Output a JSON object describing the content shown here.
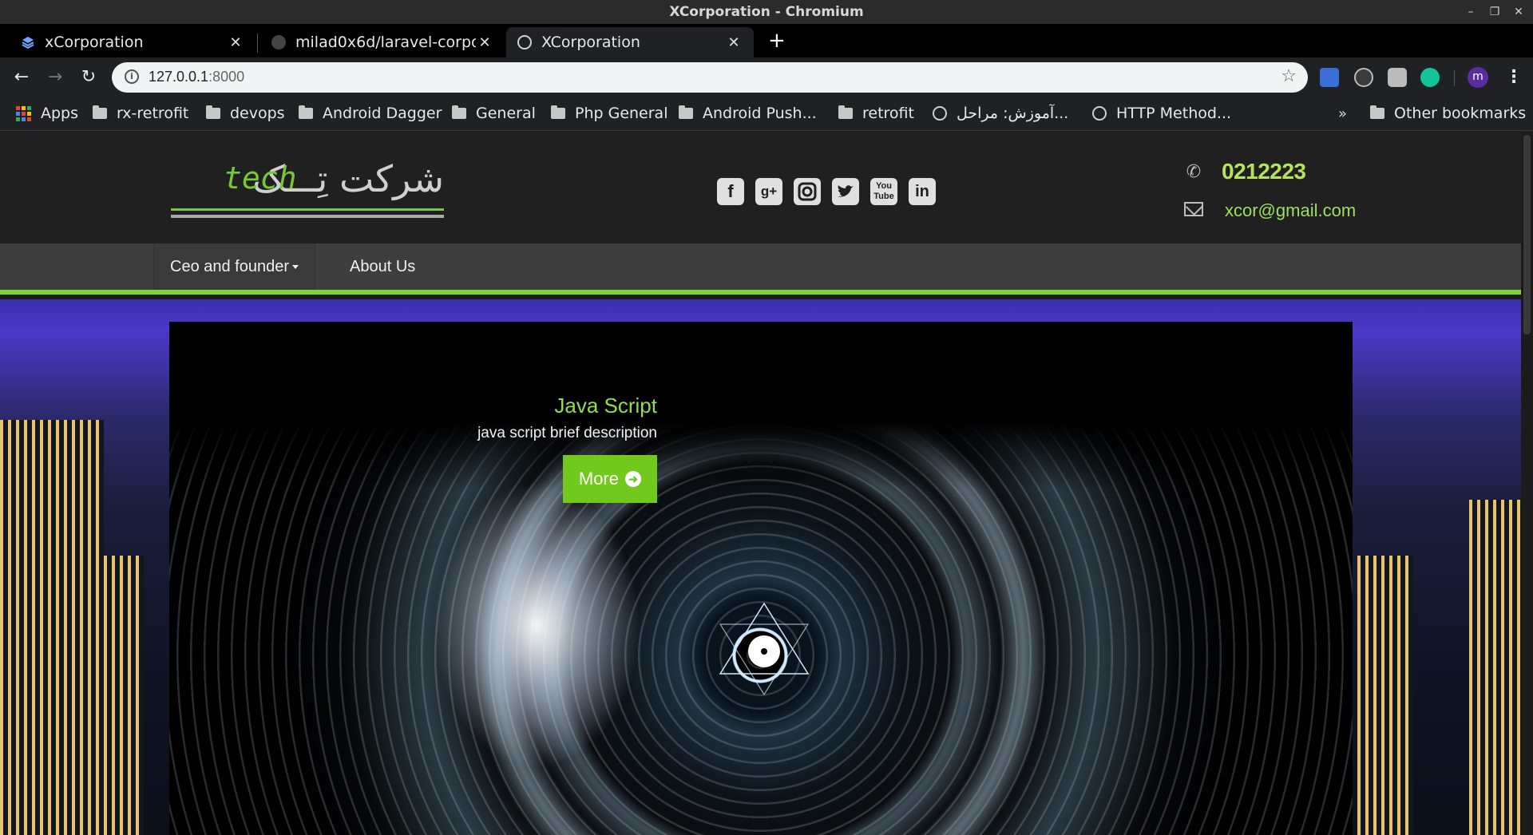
{
  "window": {
    "title": "XCorporation - Chromium"
  },
  "tabs": [
    {
      "label": "xCorporation",
      "active": false
    },
    {
      "label": "milad0x6d/laravel-corpora",
      "active": false
    },
    {
      "label": "XCorporation",
      "active": true
    }
  ],
  "toolbar": {
    "url_host": "127.0.0.1",
    "url_port": ":8000",
    "avatar_initial": "m"
  },
  "bookmarks": {
    "items": [
      "Apps",
      "rx-retrofit",
      "devops",
      "Android Dagger",
      "General",
      "Php General",
      "Android Push...",
      "retrofit",
      "آموزش: مراحل...",
      "HTTP Method..."
    ],
    "overflow": "»",
    "other": "Other bookmarks"
  },
  "site": {
    "logo": {
      "farsi": "شرکت تِـــک",
      "english": "tech"
    },
    "social_icons": [
      "facebook-icon",
      "google-plus-icon",
      "instagram-icon",
      "twitter-icon",
      "youtube-icon",
      "linkedin-icon"
    ],
    "contact": {
      "phone": "0212223",
      "email": "xcor@gmail.com"
    },
    "nav": {
      "item1": "Ceo and founder",
      "item2": "About Us"
    },
    "slide": {
      "title": "Java Script",
      "description": "java script brief description",
      "button": "More"
    },
    "colors": {
      "accent": "#7ed631",
      "header_bg": "#202020",
      "nav_bg": "#3e3e3e"
    }
  }
}
